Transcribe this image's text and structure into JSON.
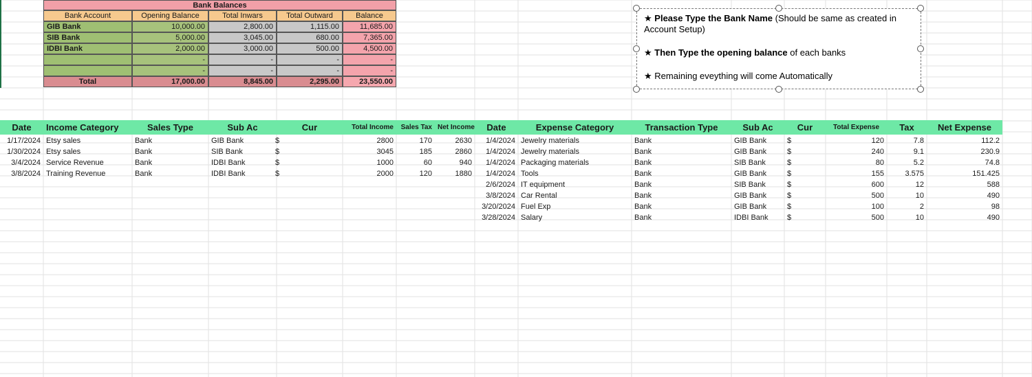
{
  "bank_balances": {
    "title": "Bank Balances",
    "headers": [
      "Bank Account",
      "Opening Balance",
      "Total Inwars",
      "Total Outward",
      "Balance"
    ],
    "rows": [
      [
        "GIB Bank",
        "10,000.00",
        "2,800.00",
        "1,115.00",
        "11,685.00"
      ],
      [
        "SIB Bank",
        "5,000.00",
        "3,045.00",
        "680.00",
        "7,365.00"
      ],
      [
        "IDBI Bank",
        "2,000.00",
        "3,000.00",
        "500.00",
        "4,500.00"
      ],
      [
        "",
        "-",
        "-",
        "-",
        "-"
      ],
      [
        "",
        "-",
        "-",
        "-",
        "-"
      ]
    ],
    "total": [
      "Total",
      "17,000.00",
      "8,845.00",
      "2,295.00",
      "23,550.00"
    ]
  },
  "note": {
    "line1_bold": "Please Type the Bank Name",
    "line1_rest": " (Should be same as created in Account Setup)",
    "line2_bold": "Then Type the opening balance",
    "line2_rest": " of each banks",
    "line3": "Remaining eveything will come Automatically",
    "bullet": "★"
  },
  "income": {
    "headers": [
      "Date",
      "Income Category",
      "Sales Type",
      "Sub Ac",
      "Cur",
      "Total Income",
      "Sales Tax",
      "Net Income"
    ],
    "rows": [
      [
        "1/17/2024",
        "Etsy sales",
        "Bank",
        "GIB Bank",
        "$",
        "2800",
        "170",
        "2630"
      ],
      [
        "1/30/2024",
        "Etsy sales",
        "Bank",
        "SIB Bank",
        "$",
        "3045",
        "185",
        "2860"
      ],
      [
        "3/4/2024",
        "Service Revenue",
        "Bank",
        "IDBI Bank",
        "$",
        "1000",
        "60",
        "940"
      ],
      [
        "3/8/2024",
        "Training Revenue",
        "Bank",
        "IDBI Bank",
        "$",
        "2000",
        "120",
        "1880"
      ]
    ]
  },
  "expense": {
    "headers": [
      "Date",
      "Expense Category",
      "Transaction Type",
      "Sub Ac",
      "Cur",
      "Total Expense",
      "Tax",
      "Net Expense"
    ],
    "rows": [
      [
        "1/4/2024",
        "Jewelry materials",
        "Bank",
        "GIB Bank",
        "$",
        "120",
        "7.8",
        "112.2"
      ],
      [
        "1/4/2024",
        "Jewelry materials",
        "Bank",
        "GIB Bank",
        "$",
        "240",
        "9.1",
        "230.9"
      ],
      [
        "1/4/2024",
        "Packaging materials",
        "Bank",
        "SIB Bank",
        "$",
        "80",
        "5.2",
        "74.8"
      ],
      [
        "1/4/2024",
        "Tools",
        "Bank",
        "GIB Bank",
        "$",
        "155",
        "3.575",
        "151.425"
      ],
      [
        "2/6/2024",
        "IT equipment",
        "Bank",
        "SIB Bank",
        "$",
        "600",
        "12",
        "588"
      ],
      [
        "3/8/2024",
        "Car Rental",
        "Bank",
        "GIB Bank",
        "$",
        "500",
        "10",
        "490"
      ],
      [
        "3/20/2024",
        "Fuel Exp",
        "Bank",
        "GIB Bank",
        "$",
        "100",
        "2",
        "98"
      ],
      [
        "3/28/2024",
        "Salary",
        "Bank",
        "IDBI Bank",
        "$",
        "500",
        "10",
        "490"
      ]
    ]
  },
  "colors": {
    "header_green": "#6ee8a6",
    "bank_title_pink": "#f2a0a8",
    "bank_header_orange": "#f6c98e",
    "bank_name_green": "#9fbf73",
    "bank_gray": "#c8c8c8",
    "bank_balance_pink": "#f4a4ac",
    "bank_total_red": "#d98c90",
    "gridline": "#e2e2e2"
  }
}
